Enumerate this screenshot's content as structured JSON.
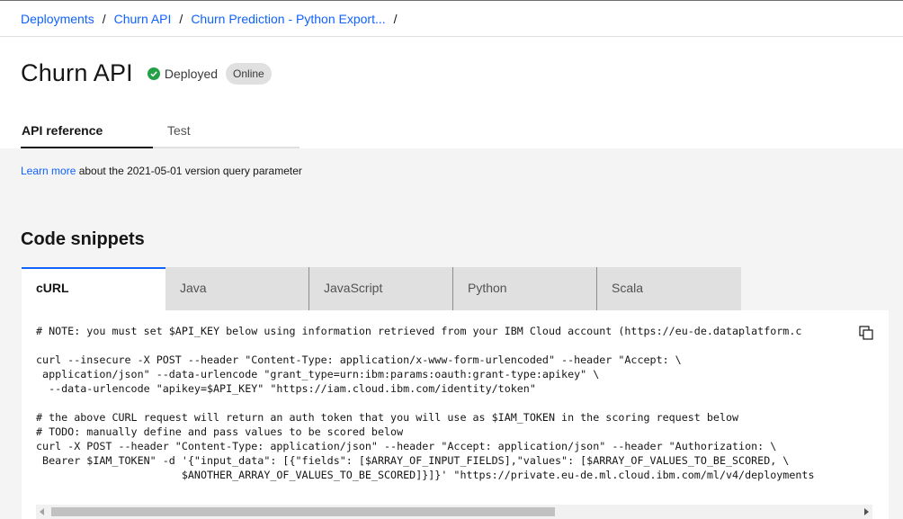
{
  "breadcrumb": {
    "items": [
      "Deployments",
      "Churn API",
      "Churn Prediction - Python Export..."
    ],
    "separator": "/"
  },
  "header": {
    "title": "Churn API",
    "status_label": "Deployed",
    "status_tag": "Online",
    "status_color": "#24a148"
  },
  "tabs": {
    "api_reference": "API reference",
    "test": "Test"
  },
  "info": {
    "link_label": "Learn more",
    "text": " about the 2021-05-01 version query parameter"
  },
  "snippets": {
    "title": "Code snippets",
    "tabs": [
      "cURL",
      "Java",
      "JavaScript",
      "Python",
      "Scala"
    ],
    "active_tab": "cURL",
    "code": "# NOTE: you must set $API_KEY below using information retrieved from your IBM Cloud account (https://eu-de.dataplatform.c\n\ncurl --insecure -X POST --header \"Content-Type: application/x-www-form-urlencoded\" --header \"Accept: \\\n application/json\" --data-urlencode \"grant_type=urn:ibm:params:oauth:grant-type:apikey\" \\\n  --data-urlencode \"apikey=$API_KEY\" \"https://iam.cloud.ibm.com/identity/token\"\n\n# the above CURL request will return an auth token that you will use as $IAM_TOKEN in the scoring request below\n# TODO: manually define and pass values to be scored below\ncurl -X POST --header \"Content-Type: application/json\" --header \"Accept: application/json\" --header \"Authorization: \\\n Bearer $IAM_TOKEN\" -d '{\"input_data\": [{\"fields\": [$ARRAY_OF_INPUT_FIELDS],\"values\": [$ARRAY_OF_VALUES_TO_BE_SCORED, \\\n                       $ANOTHER_ARRAY_OF_VALUES_TO_BE_SCORED]}]}' \"https://private.eu-de.ml.cloud.ibm.com/ml/v4/deployments",
    "copy_icon": "copy-icon"
  },
  "colors": {
    "link": "#0f62fe",
    "active_tab_accent": "#0f62fe"
  }
}
